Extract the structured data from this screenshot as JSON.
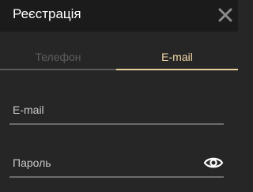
{
  "dialog": {
    "title": "Реєстрація",
    "close_icon": "close-icon"
  },
  "tabs": [
    {
      "label": "Телефон",
      "active": false
    },
    {
      "label": "E-mail",
      "active": true
    }
  ],
  "form": {
    "email": {
      "placeholder": "E-mail",
      "value": ""
    },
    "password": {
      "placeholder": "Пароль",
      "value": "",
      "toggle_icon": "eye-icon"
    }
  },
  "colors": {
    "accent": "#e8cf9e",
    "background": "#262626",
    "header": "#1b1b1b"
  }
}
